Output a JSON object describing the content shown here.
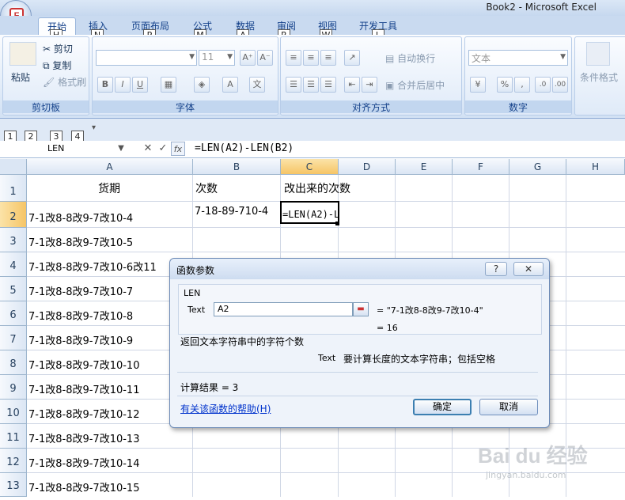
{
  "window": {
    "title": "Book2 - Microsoft Excel",
    "office_button_letter": "F"
  },
  "tabs": [
    {
      "label": "开始",
      "keytip": "H"
    },
    {
      "label": "插入",
      "keytip": "N"
    },
    {
      "label": "页面布局",
      "keytip": "P"
    },
    {
      "label": "公式",
      "keytip": "M"
    },
    {
      "label": "数据",
      "keytip": "A"
    },
    {
      "label": "审阅",
      "keytip": "R"
    },
    {
      "label": "视图",
      "keytip": "W"
    },
    {
      "label": "开发工具",
      "keytip": "L"
    }
  ],
  "ribbon": {
    "clipboard": {
      "label": "剪切板",
      "paste": "粘贴",
      "cut": "剪切",
      "copy": "复制",
      "format_painter": "格式刷"
    },
    "font": {
      "label": "字体",
      "size": "11"
    },
    "alignment": {
      "label": "对齐方式",
      "wrap": "自动换行",
      "merge": "合并后居中"
    },
    "number": {
      "label": "数字",
      "format": "文本"
    },
    "styles": {
      "conditional": "条件格式"
    }
  },
  "qat_keytips": [
    "1",
    "2",
    "3",
    "4"
  ],
  "formula_bar": {
    "name_box": "LEN",
    "formula": "=LEN(A2)-LEN(B2)"
  },
  "grid": {
    "columns": [
      "A",
      "B",
      "C",
      "D",
      "E",
      "F",
      "G",
      "H"
    ],
    "rows": [
      "1",
      "2",
      "3",
      "4",
      "5",
      "6",
      "7",
      "8",
      "9",
      "10",
      "11",
      "12",
      "13"
    ],
    "cells": {
      "A1": "货期",
      "B1": "次数",
      "C1": "改出来的次数",
      "A2": "7-1改8-8改9-7改10-4",
      "B2": "7-18-89-710-4",
      "C2": "=LEN(A2)-LEN(B2)",
      "A3": "7-1改8-8改9-7改10-5",
      "A4": "7-1改8-8改9-7改10-6改11",
      "A5": "7-1改8-8改9-7改10-7",
      "A6": "7-1改8-8改9-7改10-8",
      "A7": "7-1改8-8改9-7改10-9",
      "A8": "7-1改8-8改9-7改10-10",
      "A9": "7-1改8-8改9-7改10-11",
      "A10": "7-1改8-8改9-7改10-12",
      "A11": "7-1改8-8改9-7改10-13",
      "A12": "7-1改8-8改9-7改10-14",
      "A13": "7-1改8-8改9-7改10-15"
    }
  },
  "dialog": {
    "title": "函数参数",
    "help_btn": "?",
    "close_btn": "✕",
    "function_name": "LEN",
    "arg_label": "Text",
    "arg_value": "A2",
    "arg_result": "= \"7-1改8-8改9-7改10-4\"",
    "result_line": "= 16",
    "description": "返回文本字符串中的字符个数",
    "arg_help_name": "Text",
    "arg_help_text": "要计算长度的文本字符串；包括空格",
    "calc_result": "计算结果 = 3",
    "help_link": "有关该函数的帮助(H)",
    "ok": "确定",
    "cancel": "取消"
  },
  "watermark": {
    "brand": "Bai du 经验",
    "url": "jingyan.baidu.com"
  }
}
